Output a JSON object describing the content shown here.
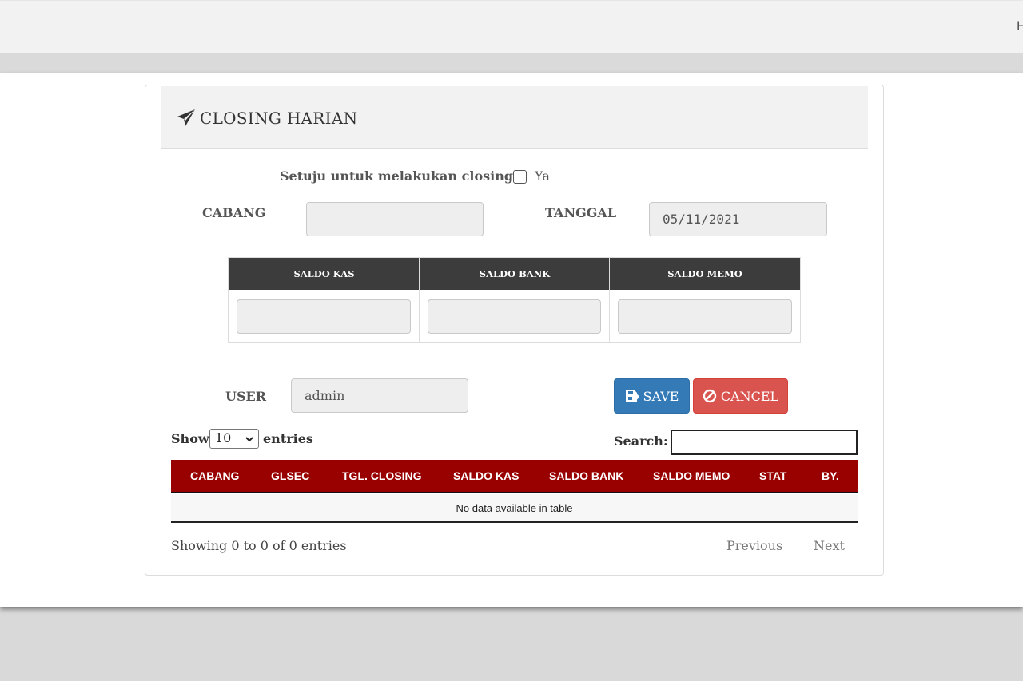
{
  "topbar": {
    "cut_text": "H"
  },
  "header": {
    "title": "CLOSING HARIAN",
    "icon": "paper-plane-icon"
  },
  "agree": {
    "label": "Setuju untuk melakukan closing :",
    "option": "Ya",
    "checked": false
  },
  "form": {
    "cabang_label": "CABANG",
    "cabang_value": "",
    "tanggal_label": "TANGGAL",
    "tanggal_value": "05/11/2021",
    "user_label": "USER",
    "user_value": "admin"
  },
  "saldo": {
    "headers": [
      "SALDO KAS",
      "SALDO BANK",
      "SALDO MEMO"
    ],
    "values": [
      "",
      "",
      ""
    ]
  },
  "buttons": {
    "save": "SAVE",
    "save_icon": "save-icon",
    "cancel": "CANCEL",
    "cancel_icon": "ban-icon"
  },
  "table_controls": {
    "show": "Show",
    "entries_value": "10",
    "entries": "entries",
    "search": "Search:"
  },
  "table": {
    "columns": [
      "CABANG",
      "GLSEC",
      "TGL. CLOSING",
      "SALDO KAS",
      "SALDO BANK",
      "SALDO MEMO",
      "STAT",
      "BY."
    ],
    "empty_message": "No data available in table"
  },
  "footer": {
    "info": "Showing 0 to 0 of 0 entries",
    "previous": "Previous",
    "next": "Next"
  },
  "colors": {
    "table_header": "#990000",
    "saldo_header": "#3c3c3c",
    "save": "#337ab7",
    "cancel": "#d9534f"
  }
}
